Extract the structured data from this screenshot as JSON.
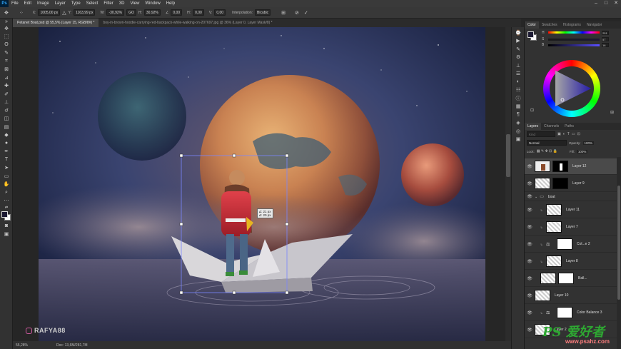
{
  "menubar": {
    "app_icon": "Ps",
    "items": [
      "File",
      "Edit",
      "Image",
      "Layer",
      "Type",
      "Select",
      "Filter",
      "3D",
      "View",
      "Window",
      "Help"
    ],
    "window_controls": [
      "–",
      "□",
      "✕"
    ]
  },
  "options_bar": {
    "x_label": "X:",
    "x_value": "1005,00 px",
    "y_label": "Y:",
    "y_value": "1163,99 px",
    "w_label": "W:",
    "w_value": "-30,92%",
    "link_label": "GO",
    "h_label": "H:",
    "h_value": "30,92%",
    "angle_label": "∠",
    "angle_value": "0,00",
    "hskew_label": "H:",
    "hskew_value": "0,00",
    "vskew_label": "V:",
    "vskew_value": "0,00",
    "interp_label": "Interpolation:",
    "interp_value": "Bicubic",
    "cancel_icon": "cancel-icon",
    "commit_icon": "commit-icon"
  },
  "tabs": [
    {
      "label": "Petanet Boat.psd @ 55,5% (Layer 15, RGB/8#) *",
      "active": true
    },
    {
      "label": "boy-in-brown-hoodie-carrying-red-backpack-while-walking-on-207697.jpg @ 36% (Layer 0, Layer Mask/8) *",
      "active": false
    }
  ],
  "statusbar": {
    "zoom": "55,28%",
    "doc": "Doc: 13,6M/281,7M"
  },
  "transform_tooltip": {
    "dx": "Δ: 21 px",
    "dy": "Δ: 20 px"
  },
  "color_panel": {
    "tabs": [
      "Color",
      "Swatches",
      "Histograms",
      "Navigator"
    ],
    "sliders": [
      {
        "label": "H",
        "value": "251"
      },
      {
        "label": "S",
        "value": "57"
      },
      {
        "label": "B",
        "value": "16"
      }
    ],
    "foreground": "#1c1a33",
    "background": "#ffffff"
  },
  "layers_panel": {
    "tabs": [
      "Layers",
      "Channels",
      "Paths"
    ],
    "search_placeholder": "Kind",
    "blend_mode": "Normal",
    "opacity_label": "Opacity:",
    "opacity_value": "100%",
    "lock_label": "Lock:",
    "fill_label": "Fill:",
    "fill_value": "100%",
    "layers": [
      {
        "name": "Layer 12",
        "selected": true
      },
      {
        "name": "Layer 9",
        "selected": false
      },
      {
        "name": "boat",
        "selected": false
      },
      {
        "name": "Layer 11",
        "selected": false
      },
      {
        "name": "Layer 7",
        "selected": false
      },
      {
        "name": "Col...e 2",
        "selected": false
      },
      {
        "name": "Layer 8",
        "selected": false
      },
      {
        "name": "Ball...",
        "selected": false
      },
      {
        "name": "Layer 10",
        "selected": false
      },
      {
        "name": "Color Balance 3",
        "selected": false
      },
      {
        "name": "Layer 2",
        "selected": false
      }
    ]
  },
  "watermark": {
    "handle": "RAFYA88"
  },
  "site_logo": {
    "text": "PS 爱好者",
    "url": "www.psahz.com"
  }
}
